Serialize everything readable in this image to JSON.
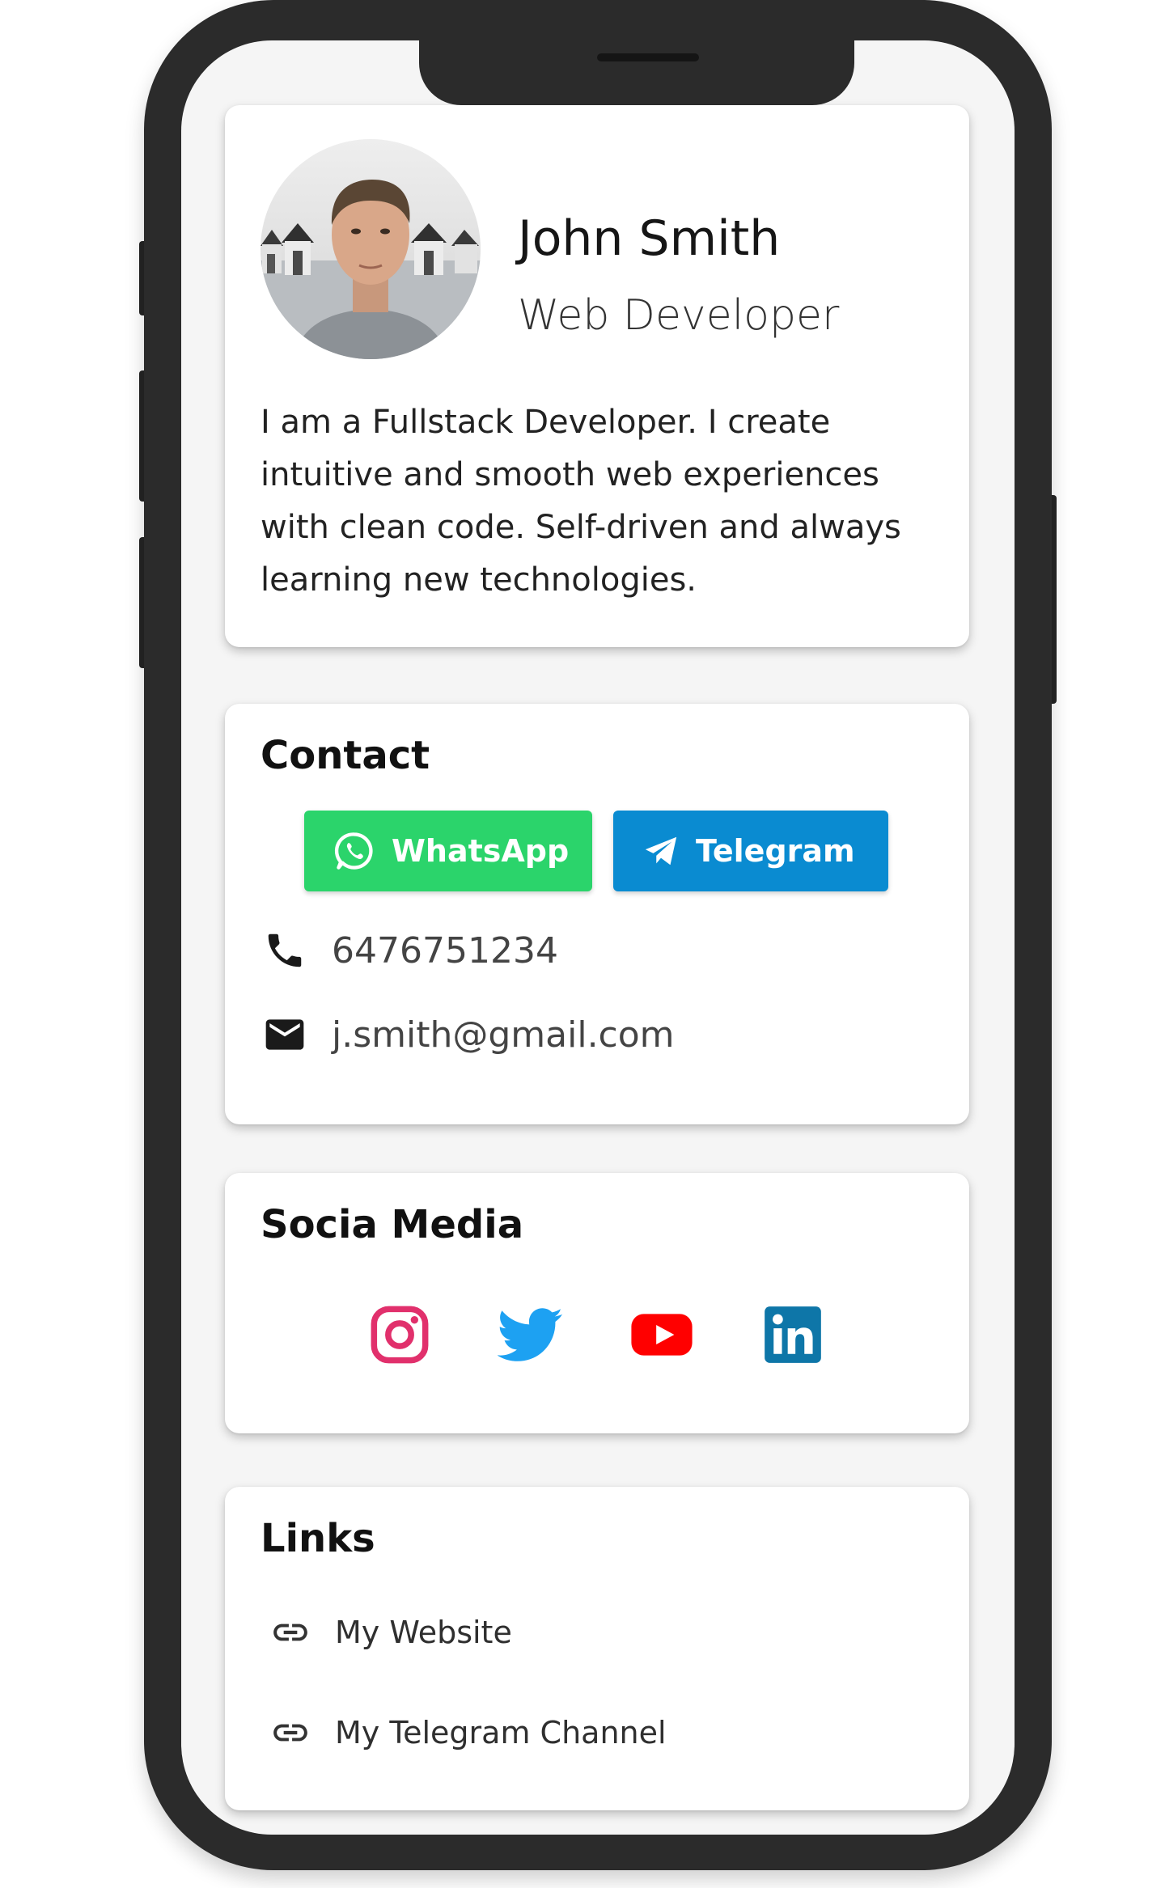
{
  "theme": {
    "whatsapp_color": "#2bd46b",
    "telegram_color": "#0a8bd1",
    "instagram_color": "#e1306c",
    "twitter_color": "#1da1f2",
    "youtube_color": "#ff0000",
    "linkedin_color": "#0e76a8"
  },
  "profile": {
    "name": "John Smith",
    "role": "Web Developer",
    "bio": "I am a Fullstack Developer. I create intuitive and smooth web experiences with clean code. Self-driven and always learning new technologies.",
    "avatar_icon": "profile-photo"
  },
  "contact": {
    "title": "Contact",
    "whatsapp_label": "WhatsApp",
    "telegram_label": "Telegram",
    "phone": "6476751234",
    "email": "j.smith@gmail.com",
    "phone_icon": "phone-icon",
    "email_icon": "mail-icon"
  },
  "social": {
    "title": "Socia Media",
    "icons": [
      "instagram-icon",
      "twitter-icon",
      "youtube-icon",
      "linkedin-icon"
    ]
  },
  "links": {
    "title": "Links",
    "items": [
      {
        "label": "My Website",
        "icon": "link-icon"
      },
      {
        "label": "My Telegram Channel",
        "icon": "link-icon"
      }
    ]
  }
}
